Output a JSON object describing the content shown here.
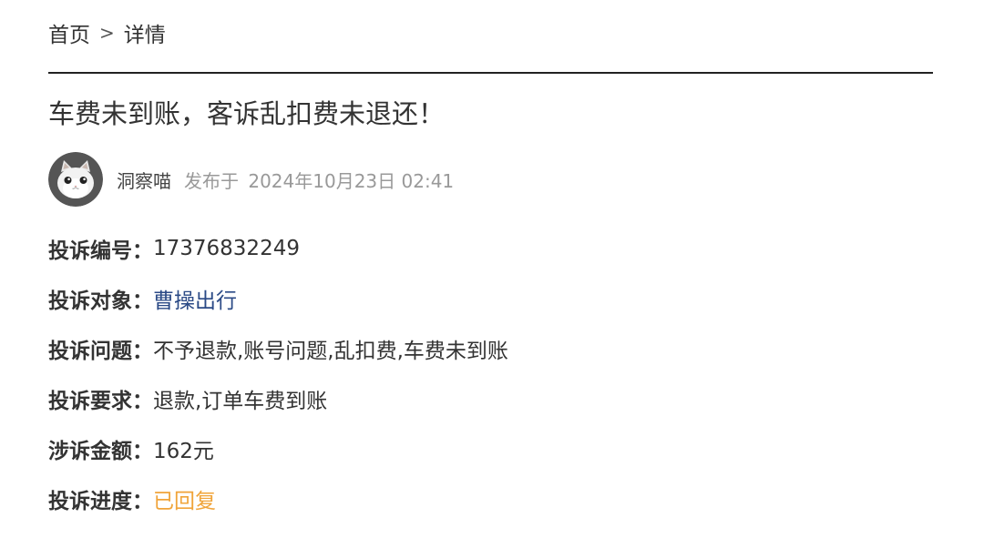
{
  "breadcrumb": {
    "home": "首页",
    "separator": ">",
    "current": "详情"
  },
  "post": {
    "title": "车费未到账，客诉乱扣费未退还！",
    "author": "洞察喵",
    "posted_prefix": "发布于",
    "posted_date": "2024年10月23日 02:41",
    "avatar_icon": "cat-avatar-icon"
  },
  "details": [
    {
      "label": "投诉编号：",
      "value": "17376832249"
    },
    {
      "label": "投诉对象：",
      "value": "曹操出行"
    },
    {
      "label": "投诉问题：",
      "value": "不予退款,账号问题,乱扣费,车费未到账"
    },
    {
      "label": "投诉要求：",
      "value": "退款,订单车费到账"
    },
    {
      "label": "涉诉金额：",
      "value": "162元"
    },
    {
      "label": "投诉进度：",
      "value": "已回复"
    }
  ],
  "colors": {
    "link": "#2b4a86",
    "status": "#f0a43a",
    "muted": "#999999",
    "text": "#333333",
    "divider": "#222222"
  }
}
